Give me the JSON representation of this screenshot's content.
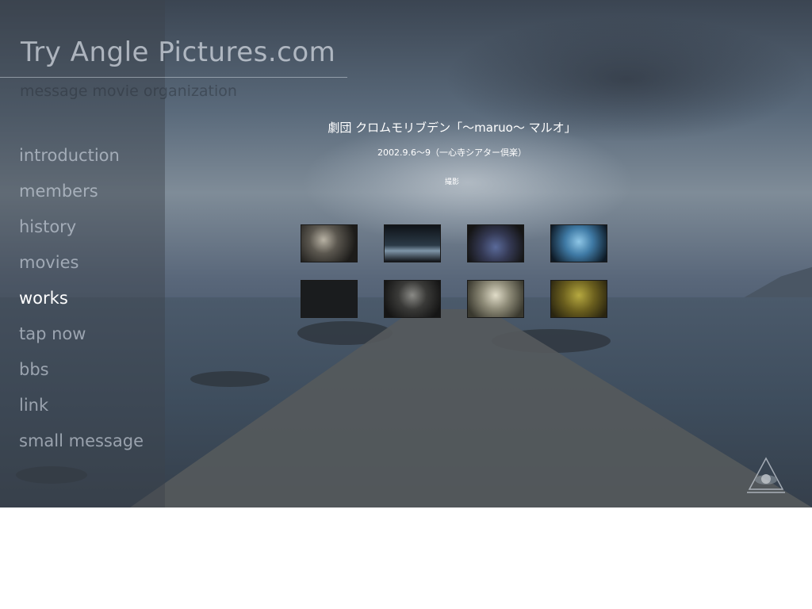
{
  "site": {
    "title": "Try Angle Pictures.com",
    "tagline": "message movie organization"
  },
  "nav": {
    "items": [
      {
        "label": "introduction",
        "active": false
      },
      {
        "label": "members",
        "active": false
      },
      {
        "label": "history",
        "active": false
      },
      {
        "label": "movies",
        "active": false
      },
      {
        "label": "works",
        "active": true
      },
      {
        "label": "tap now",
        "active": false
      },
      {
        "label": "bbs",
        "active": false
      },
      {
        "label": "link",
        "active": false
      },
      {
        "label": "small message",
        "active": false
      }
    ]
  },
  "work": {
    "title": "劇団 クロムモリブデン「〜maruo〜 マルオ」",
    "date": "2002.9.6〜9（一心寺シアター倶楽）",
    "role": "撮影"
  },
  "thumbnails": [
    {
      "icon": "video-still-1"
    },
    {
      "icon": "video-still-2"
    },
    {
      "icon": "video-still-3"
    },
    {
      "icon": "video-still-4"
    },
    {
      "icon": "video-still-5"
    },
    {
      "icon": "video-still-6"
    },
    {
      "icon": "video-still-7"
    },
    {
      "icon": "video-still-8"
    }
  ],
  "colors": {
    "nav_inactive": "#cdd4de",
    "nav_active": "#ffffff",
    "text": "#ffffff"
  },
  "logo": {
    "icon": "triangle-eye-logo"
  }
}
